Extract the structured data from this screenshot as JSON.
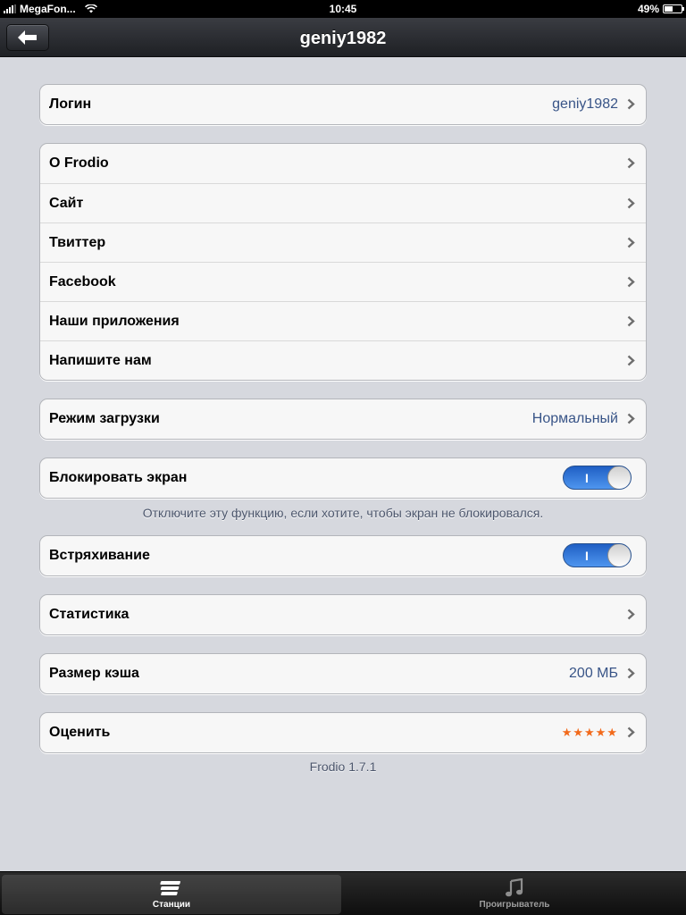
{
  "status_bar": {
    "carrier": "MegaFon...",
    "time": "10:45",
    "battery": "49%",
    "battery_level": 0.49
  },
  "nav": {
    "title": "geniy1982",
    "back_icon": "back-arrow-icon"
  },
  "groups": {
    "login": {
      "label": "Логин",
      "value": "geniy1982"
    },
    "about": [
      {
        "label": "О Frodio"
      },
      {
        "label": "Сайт"
      },
      {
        "label": "Твиттер"
      },
      {
        "label": "Facebook"
      },
      {
        "label": "Наши приложения"
      },
      {
        "label": "Напишите нам"
      }
    ],
    "download_mode": {
      "label": "Режим загрузки",
      "value": "Нормальный"
    },
    "lock_screen": {
      "label": "Блокировать экран",
      "toggle_label": "I",
      "on": true,
      "footnote": "Отключите эту функцию, если хотите, чтобы экран не блокировался."
    },
    "shake": {
      "label": "Встряхивание",
      "toggle_label": "I",
      "on": true
    },
    "stats": {
      "label": "Статистика"
    },
    "cache": {
      "label": "Размер кэша",
      "value": "200 МБ"
    },
    "rate": {
      "label": "Оценить",
      "stars": "★★★★★"
    }
  },
  "version": "Frodio 1.7.1",
  "tabbar": {
    "tabs": [
      {
        "label": "Станции",
        "icon": "stations-icon",
        "selected": true
      },
      {
        "label": "Проигрыватель",
        "icon": "music-note-icon",
        "selected": false
      }
    ]
  },
  "colors": {
    "value_text": "#385487",
    "stars": "#f26a1b",
    "toggle_on": "#1f5fc4"
  }
}
